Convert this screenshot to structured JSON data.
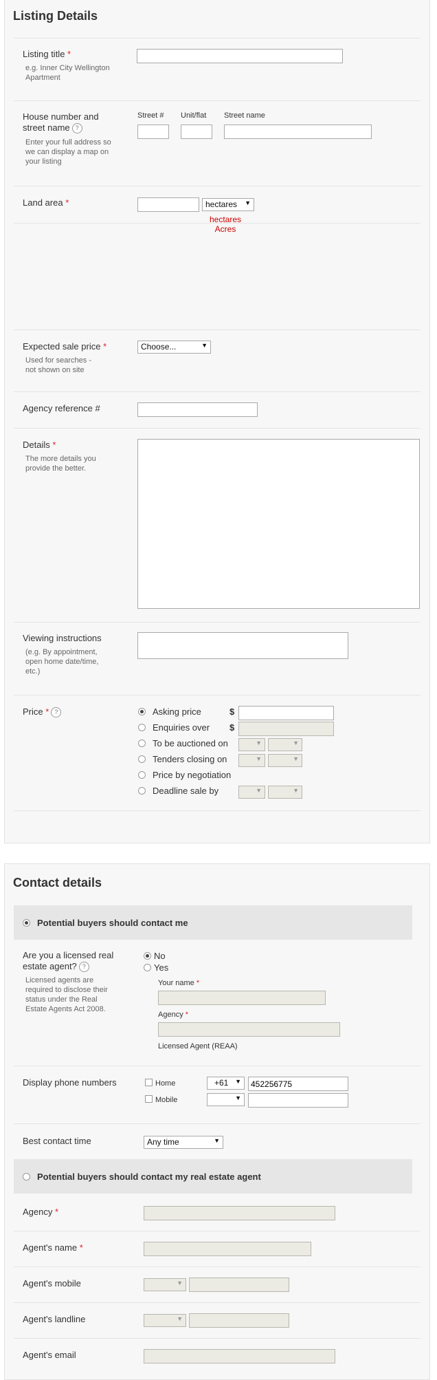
{
  "listing": {
    "title": "Listing Details",
    "listing_title": {
      "label": "Listing title",
      "required": "*",
      "help": "e.g. Inner City Wellington Apartment"
    },
    "address": {
      "label": "House number and street name",
      "help": "Enter your full address so we can display a map on your listing",
      "street_no": "Street #",
      "unit": "Unit/flat",
      "street_name": "Street name"
    },
    "land_area": {
      "label": "Land area",
      "required": "*",
      "unit_selected": "hectares",
      "options": [
        "hectares",
        "Acres"
      ]
    },
    "sale_price": {
      "label": "Expected sale price",
      "required": "*",
      "help": "Used for searches - not shown on site",
      "selected": "Choose..."
    },
    "agency_ref": {
      "label": "Agency reference #"
    },
    "details": {
      "label": "Details",
      "required": "*",
      "help": "The more details you provide the better."
    },
    "viewing": {
      "label": "Viewing instructions",
      "help": "(e.g. By appointment, open home date/time, etc.)"
    },
    "price": {
      "label": "Price",
      "required": "*",
      "currency": "$",
      "options": [
        "Asking price",
        "Enquiries over",
        "To be auctioned on",
        "Tenders closing on",
        "Price by negotiation",
        "Deadline sale by"
      ],
      "selected_index": 0
    }
  },
  "contact": {
    "title": "Contact details",
    "option_me": "Potential buyers should contact me",
    "licensed": {
      "label": "Are you a licensed real estate agent?",
      "help": "Licensed agents are required to disclose their status under the Real Estate Agents Act 2008.",
      "no": "No",
      "yes": "Yes",
      "selected": "No"
    },
    "your_name": {
      "label": "Your name",
      "required": "*"
    },
    "agency": {
      "label": "Agency",
      "required": "*"
    },
    "licensed_note": "Licensed Agent (REAA)",
    "phones": {
      "label": "Display phone numbers",
      "home": "Home",
      "mobile": "Mobile",
      "home_code": "+61",
      "home_number": "452256775",
      "mobile_code": ""
    },
    "best_time": {
      "label": "Best contact time",
      "selected": "Any time"
    },
    "option_agent": "Potential buyers should contact my real estate agent",
    "agent": {
      "agency": "Agency",
      "agency_required": "*",
      "name": "Agent's name",
      "name_required": "*",
      "mobile": "Agent's mobile",
      "landline": "Agent's landline",
      "email": "Agent's email"
    }
  }
}
